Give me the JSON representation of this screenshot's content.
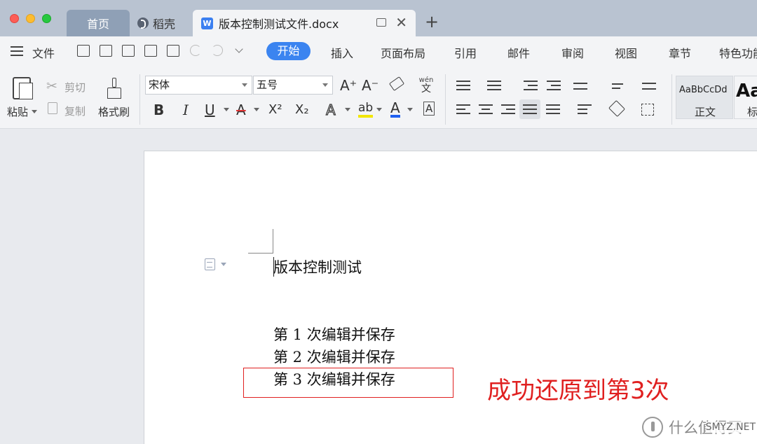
{
  "window": {
    "tabs": [
      {
        "label": "首页"
      },
      {
        "label": "稻壳"
      },
      {
        "label": "版本控制测试文件.docx"
      }
    ],
    "new_tab_glyph": "+",
    "close_glyph": "✕"
  },
  "menu": {
    "file_label": "文件",
    "tabs": [
      "开始",
      "插入",
      "页面布局",
      "引用",
      "邮件",
      "审阅",
      "视图",
      "章节",
      "特色功能"
    ],
    "active_tab": "开始"
  },
  "ribbon": {
    "paste_label": "粘贴",
    "cut_label": "剪切",
    "copy_label": "复制",
    "format_painter_label": "格式刷",
    "font_name": "宋体",
    "font_size": "五号",
    "grow_font": "A⁺",
    "shrink_font": "A⁻",
    "pinyin_top": "wén",
    "pinyin_bottom": "文",
    "bold": "B",
    "italic": "I",
    "underline": "U",
    "strike": "A",
    "superscript": "X²",
    "subscript": "X₂",
    "text_effect": "A",
    "highlight": "ab",
    "font_color": "A",
    "char_border": "A",
    "styles": [
      {
        "preview": "AaBbCcDd",
        "name": "正文"
      },
      {
        "preview": "Aa",
        "name": "标"
      }
    ]
  },
  "document": {
    "title_line": "版本控制测试",
    "lines": [
      "第 1 次编辑并保存",
      "第 2 次编辑并保存",
      "第 3 次编辑并保存"
    ]
  },
  "annotation": {
    "text": "成功还原到第3次",
    "color": "#e02020"
  },
  "watermark": {
    "text": "什么值得买",
    "site": "SMYZ.NET"
  },
  "colors": {
    "accent": "#3b84f0",
    "tab_bar": "#b9c3d1",
    "annotation_red": "#e02020"
  }
}
